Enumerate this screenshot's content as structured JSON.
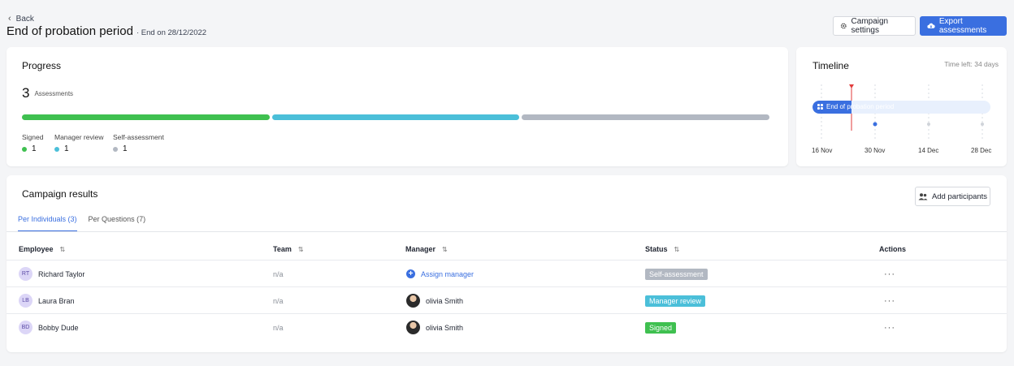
{
  "header": {
    "back_label": "Back",
    "title": "End of probation period",
    "subtitle": "· End on 28/12/2022",
    "settings_label": "Campaign settings",
    "export_label": "Export assessments"
  },
  "progress": {
    "title": "Progress",
    "count": "3",
    "count_label": "Assessments",
    "segments": [
      {
        "name": "Signed",
        "value": "1",
        "color": "#3fc050",
        "fraction": 0.3333
      },
      {
        "name": "Manager review",
        "value": "1",
        "color": "#4bbfd9",
        "fraction": 0.3333
      },
      {
        "name": "Self-assessment",
        "value": "1",
        "color": "#b2b8c2",
        "fraction": 0.3334
      }
    ]
  },
  "timeline": {
    "title": "Timeline",
    "time_left": "Time left: 34 days",
    "event_label": "End of probation period",
    "dates": [
      "16 Nov",
      "30 Nov",
      "14 Dec",
      "28 Dec"
    ]
  },
  "results": {
    "title": "Campaign results",
    "add_label": "Add participants",
    "tabs": [
      "Per Individuals (3)",
      "Per Questions (7)"
    ],
    "columns": [
      "Employee",
      "Team",
      "Manager",
      "Status",
      "Actions"
    ],
    "rows": [
      {
        "initials": "RT",
        "name": "Richard Taylor",
        "team": "n/a",
        "manager": "Assign manager",
        "status": "Self-assessment",
        "status_color": "#b2b8c2"
      },
      {
        "initials": "LB",
        "name": "Laura Bran",
        "team": "n/a",
        "manager": "olivia Smith",
        "status": "Manager review",
        "status_color": "#4bbfd9"
      },
      {
        "initials": "BD",
        "name": "Bobby Dude",
        "team": "n/a",
        "manager": "olivia Smith",
        "status": "Signed",
        "status_color": "#3fc050"
      }
    ],
    "actions_glyph": "···"
  }
}
